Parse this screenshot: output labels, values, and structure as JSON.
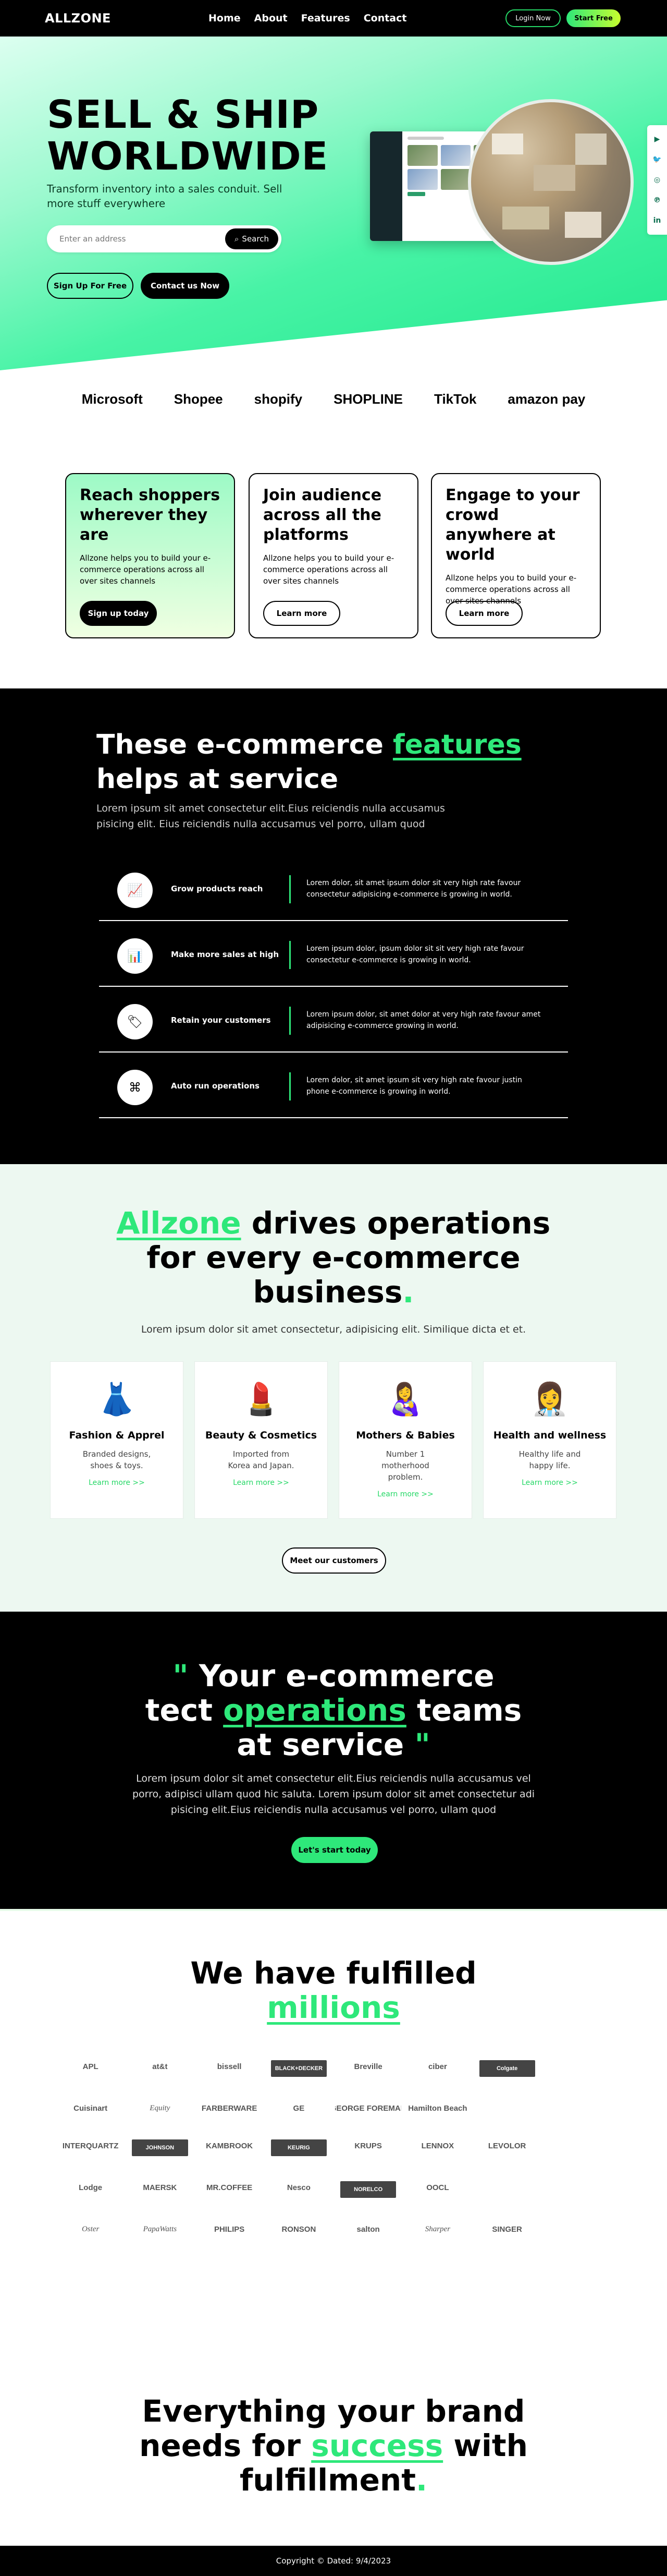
{
  "header": {
    "logo": "ALLZONE",
    "nav": [
      "Home",
      "About",
      "Features",
      "Contact"
    ],
    "login_label": "Login Now",
    "start_label": "Start Free"
  },
  "hero": {
    "title_line1": "SELL & SHIP",
    "title_line2": "WORLDWIDE",
    "subtitle": "Transform inventory into a sales conduit. Sell more stuff everywhere",
    "search_placeholder": "Enter an address",
    "search_button": "Search",
    "signup_label": "Sign Up For Free",
    "contact_label": "Contact us Now",
    "social_icons": [
      "youtube-icon",
      "twitter-icon",
      "instagram-icon",
      "pinterest-icon",
      "linkedin-icon"
    ]
  },
  "partners": [
    "Microsoft",
    "Shopee",
    "shopify",
    "SHOPLINE",
    "TikTok",
    "amazon pay"
  ],
  "cards": [
    {
      "title": "Reach shoppers wherever they are",
      "text": "Allzone helps you to build your e-commerce operations across all over sites channels",
      "button": "Sign up today"
    },
    {
      "title": "Join audience across all the platforms",
      "text": "Allzone helps you to build your e-commerce operations across all over sites channels",
      "button": "Learn more"
    },
    {
      "title": "Engage to your crowd anywhere at world",
      "text": "Allzone helps you to build your e-commerce operations across all over sites channels",
      "button": "Learn more"
    }
  ],
  "features": {
    "title_pre": "These e-commerce ",
    "title_hl": "features",
    "title_post": " helps at service",
    "subtitle": "Lorem ipsum sit amet consectetur elit.Eius reiciendis nulla accusamus pisicing elit. Eius reiciendis nulla accusamus vel porro, ullam quod",
    "items": [
      {
        "name": "Grow products reach",
        "desc": "Lorem dolor, sit amet ipsum dolor sit very high rate favour consectetur adipisicing e-commerce is growing in world."
      },
      {
        "name": "Make more sales at high",
        "desc": "Lorem ipsum dolor, ipsum dolor sit sit very high rate favour consectetur e-commerce is growing in world."
      },
      {
        "name": "Retain your customers",
        "desc": "Lorem ipsum dolor, sit amet dolor at very high rate favour amet adipisicing e-commerce growing in world."
      },
      {
        "name": "Auto run operations",
        "desc": "Lorem dolor, sit amet ipsum sit very high rate favour justin phone e-commerce is growing in world."
      }
    ]
  },
  "operations": {
    "title_hl": "Allzone",
    "title_l1_rest": " drives operations",
    "title_l2": "for every e-commerce",
    "title_l3": "business",
    "title_dot": ".",
    "subtitle": "Lorem ipsum dolor sit amet consectetur, adipisicing elit. Similique dicta et et.",
    "products": [
      {
        "icon": "dress-icon",
        "glyph": "👗",
        "name": "Fashion & Apprel",
        "text": "Branded designs, shoes & toys.",
        "link": "Learn more >>"
      },
      {
        "icon": "lipstick-icon",
        "glyph": "💄",
        "name": "Beauty & Cosmetics",
        "text": "Imported from Korea and Japan.",
        "link": "Learn more >>"
      },
      {
        "icon": "mother-icon",
        "glyph": "👩‍🍼",
        "name": "Mothers & Babies",
        "text": "Number 1 motherhood problem.",
        "link": "Learn more >>"
      },
      {
        "icon": "doctor-icon",
        "glyph": "👩‍⚕️",
        "name": "Health and wellness",
        "text": "Healthy life and happy life.",
        "link": "Learn more >>"
      }
    ],
    "meet_label": "Meet our customers"
  },
  "quote": {
    "q_open": "\"",
    "l1": " Your e-commerce",
    "l2_pre": "tect ",
    "l2_hl": "operations",
    "l2_post": " teams",
    "l3": "at service ",
    "q_close": "\"",
    "subtitle": "Lorem ipsum dolor sit amet consectetur elit.Eius reiciendis nulla accusamus vel porro, adipisci ullam quod hic saluta. Lorem ipsum dolor sit amet consectetur adi pisicing elit.Eius reiciendis nulla accusamus vel porro, ullam quod",
    "button": "Let's start today"
  },
  "brands": {
    "title_l1": "We have fulfilled",
    "title_hl": "millions",
    "items": [
      "APL",
      "at&t",
      "bissell",
      "BLACK+DECKER",
      "Breville",
      "ciber",
      "Colgate",
      "",
      "Cuisinart",
      "Equity",
      "FARBERWARE",
      "GE",
      "GEORGE FOREMAN",
      "Hamilton Beach",
      "",
      "",
      "INTERQUARTZ",
      "JOHNSON",
      "KAMBROOK",
      "KEURIG",
      "KRUPS",
      "LENNOX",
      "LEVOLOR",
      "",
      "Lodge",
      "MAERSK",
      "MR.COFFEE",
      "Nesco",
      "NORELCO",
      "OOCL",
      "",
      "",
      "Oster",
      "PapaWatts",
      "PHILIPS",
      "RONSON",
      "salton",
      "Sharper",
      "SINGER",
      ""
    ]
  },
  "fulfill": {
    "l1": "Everything your brand",
    "l2_pre": "needs for ",
    "l2_hl": "success",
    "l2_post": " with",
    "l3": "fulfillment",
    "dot": "."
  },
  "footer": {
    "text": "Copyright © Dated: 9/4/2023"
  }
}
